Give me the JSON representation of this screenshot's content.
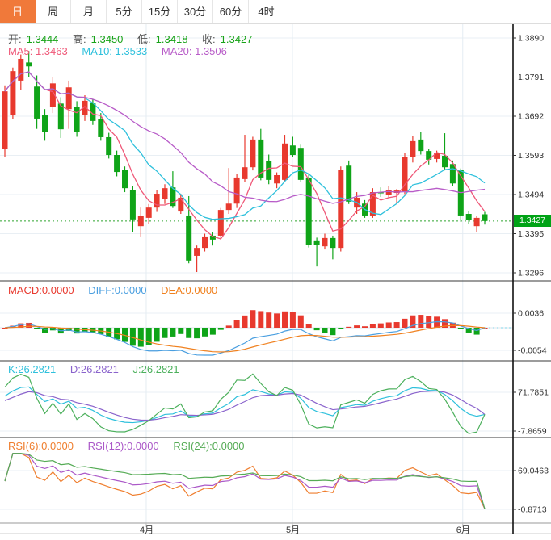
{
  "tabs": [
    {
      "label": "日",
      "active": true
    },
    {
      "label": "周",
      "active": false
    },
    {
      "label": "月",
      "active": false
    },
    {
      "label": "5分",
      "active": false
    },
    {
      "label": "15分",
      "active": false
    },
    {
      "label": "30分",
      "active": false
    },
    {
      "label": "60分",
      "active": false
    },
    {
      "label": "4时",
      "active": false
    }
  ],
  "colors": {
    "up": "#e8392e",
    "down": "#0fa418",
    "ma5": "#ef5878",
    "ma10": "#2ec0dc",
    "ma20": "#b85cc8",
    "diff": "#4a9fe0",
    "dea": "#f0811f",
    "k": "#2ec0dc",
    "d": "#8a63cc",
    "j": "#4cb05c",
    "rsi6": "#ef7e2e",
    "rsi12": "#ab58c8",
    "rsi24": "#55ab55",
    "tab_active_bg": "#f0793a",
    "price_tag_bg": "#00a316",
    "price_line": "#2fa52f",
    "grid": "#e9eff4",
    "vgrid": "#e4ecf2",
    "separator": "#3a3a3a",
    "axis_line": "#111",
    "axis_text": "#333"
  },
  "main": {
    "ohlc": {
      "o_label": "开:",
      "o": "1.3444",
      "h_label": "高:",
      "h": "1.3450",
      "l_label": "低:",
      "l": "1.3418",
      "c_label": "收:",
      "c": "1.3427"
    },
    "ma": {
      "ma5": "MA5: 1.3463",
      "ma10": "MA10: 1.3533",
      "ma20": "MA20: 1.3506"
    },
    "y_axis": [
      "1.3890",
      "1.3791",
      "1.3692",
      "1.3593",
      "1.3494",
      "1.3395",
      "1.3296"
    ],
    "price_tag": "1.3427"
  },
  "macd": {
    "labels": {
      "macd": "MACD:0.0000",
      "diff": "DIFF:0.0000",
      "dea": "DEA:0.0000"
    },
    "y_axis": [
      "0.0036",
      "-0.0054"
    ]
  },
  "kdj": {
    "labels": {
      "k": "K:26.2821",
      "d": "D:26.2821",
      "j": "J:26.2821"
    },
    "y_axis": [
      "71.7851",
      "-7.8659"
    ]
  },
  "rsi": {
    "labels": {
      "r6": "RSI(6):0.0000",
      "r12": "RSI(12):0.0000",
      "r24": "RSI(24):0.0000"
    },
    "y_axis": [
      "69.0463",
      "-0.8713"
    ]
  },
  "x_axis": {
    "months": [
      {
        "label": "4月",
        "frac": 0.285
      },
      {
        "label": "5月",
        "frac": 0.57
      },
      {
        "label": "6月",
        "frac": 0.902
      }
    ]
  },
  "chart_data": {
    "type": "candlestick",
    "title": "",
    "x_axis_months": [
      "4月",
      "5月",
      "6月"
    ],
    "y_axis_ticks": [
      1.389,
      1.3791,
      1.3692,
      1.3593,
      1.3494,
      1.3395,
      1.3296
    ],
    "last_price": 1.3427,
    "ma_periods": [
      5,
      10,
      20
    ],
    "macd_params": [
      12,
      26,
      9
    ],
    "kdj_params": [
      9,
      3,
      3
    ],
    "rsi_periods": [
      6,
      12,
      24
    ],
    "indicator_axis_ticks": {
      "macd": [
        0.0036,
        -0.0054
      ],
      "kdj": [
        71.7851,
        -7.8659
      ],
      "rsi": [
        69.0463,
        -0.8713
      ]
    },
    "last_values": {
      "macd": {
        "macd": 0,
        "diff": 0,
        "dea": 0
      },
      "kdj": {
        "k": 26.2821,
        "d": 26.2821,
        "j": 26.2821
      },
      "rsi": {
        "rsi6": 0,
        "rsi12": 0,
        "rsi24": 0
      }
    },
    "candles": [
      [
        1.361,
        1.377,
        1.359,
        1.3755
      ],
      [
        1.3694,
        1.3815,
        1.3685,
        1.3806
      ],
      [
        1.3782,
        1.3848,
        1.3758,
        1.3837
      ],
      [
        1.3828,
        1.3857,
        1.379,
        1.3818
      ],
      [
        1.3767,
        1.3795,
        1.366,
        1.3686
      ],
      [
        1.3694,
        1.371,
        1.363,
        1.3653
      ],
      [
        1.3716,
        1.379,
        1.37,
        1.3775
      ],
      [
        1.3724,
        1.374,
        1.3637,
        1.3659
      ],
      [
        1.371,
        1.3782,
        1.366,
        1.3765
      ],
      [
        1.3716,
        1.373,
        1.364,
        1.3653
      ],
      [
        1.3696,
        1.3745,
        1.368,
        1.3731
      ],
      [
        1.3726,
        1.3736,
        1.367,
        1.368
      ],
      [
        1.3684,
        1.37,
        1.363,
        1.3639
      ],
      [
        1.3639,
        1.365,
        1.3585,
        1.3594
      ],
      [
        1.3594,
        1.3605,
        1.354,
        1.3551
      ],
      [
        1.3557,
        1.3565,
        1.35,
        1.351
      ],
      [
        1.3506,
        1.3516,
        1.34,
        1.3431
      ],
      [
        1.3414,
        1.3461,
        1.3388,
        1.3439
      ],
      [
        1.3435,
        1.347,
        1.342,
        1.3461
      ],
      [
        1.3461,
        1.3505,
        1.345,
        1.3496
      ],
      [
        1.3482,
        1.352,
        1.347,
        1.351
      ],
      [
        1.3512,
        1.3553,
        1.346,
        1.3465
      ],
      [
        1.3451,
        1.3496,
        1.3445,
        1.3486
      ],
      [
        1.3441,
        1.349,
        1.332,
        1.3327
      ],
      [
        1.3339,
        1.3365,
        1.3298,
        1.3359
      ],
      [
        1.3359,
        1.3395,
        1.335,
        1.3388
      ],
      [
        1.339,
        1.3398,
        1.3365,
        1.338
      ],
      [
        1.339,
        1.346,
        1.338,
        1.3455
      ],
      [
        1.3455,
        1.3561,
        1.3445,
        1.3471
      ],
      [
        1.3471,
        1.3545,
        1.346,
        1.3537
      ],
      [
        1.3533,
        1.3645,
        1.3525,
        1.3563
      ],
      [
        1.3563,
        1.364,
        1.3555,
        1.3633
      ],
      [
        1.3633,
        1.366,
        1.353,
        1.3537
      ],
      [
        1.3578,
        1.3595,
        1.352,
        1.3531
      ],
      [
        1.3522,
        1.355,
        1.351,
        1.3543
      ],
      [
        1.3531,
        1.3645,
        1.3525,
        1.3623
      ],
      [
        1.3618,
        1.364,
        1.3588,
        1.3594
      ],
      [
        1.3612,
        1.362,
        1.3525,
        1.3531
      ],
      [
        1.3537,
        1.3545,
        1.336,
        1.3367
      ],
      [
        1.3378,
        1.3385,
        1.3312,
        1.3367
      ],
      [
        1.3363,
        1.3395,
        1.3355,
        1.3384
      ],
      [
        1.3384,
        1.339,
        1.333,
        1.3359
      ],
      [
        1.3359,
        1.3565,
        1.335,
        1.3557
      ],
      [
        1.3567,
        1.358,
        1.347,
        1.3476
      ],
      [
        1.3461,
        1.35,
        1.3445,
        1.3486
      ],
      [
        1.3471,
        1.348,
        1.3435,
        1.3441
      ],
      [
        1.3441,
        1.351,
        1.3435,
        1.35
      ],
      [
        1.35,
        1.3512,
        1.3488,
        1.3497
      ],
      [
        1.3492,
        1.3515,
        1.3485,
        1.3506
      ],
      [
        1.3498,
        1.3508,
        1.347,
        1.3504
      ],
      [
        1.3502,
        1.36,
        1.3495,
        1.3588
      ],
      [
        1.3588,
        1.3643,
        1.3575,
        1.3629
      ],
      [
        1.3633,
        1.3653,
        1.3595,
        1.3604
      ],
      [
        1.3604,
        1.361,
        1.357,
        1.3582
      ],
      [
        1.3584,
        1.3605,
        1.3575,
        1.3598
      ],
      [
        1.3592,
        1.3649,
        1.3555,
        1.3563
      ],
      [
        1.3571,
        1.358,
        1.3515,
        1.3522
      ],
      [
        1.3556,
        1.356,
        1.3425,
        1.3441
      ],
      [
        1.3445,
        1.3452,
        1.342,
        1.3429
      ],
      [
        1.3414,
        1.344,
        1.34,
        1.3435
      ],
      [
        1.3444,
        1.345,
        1.3418,
        1.3427
      ]
    ]
  }
}
